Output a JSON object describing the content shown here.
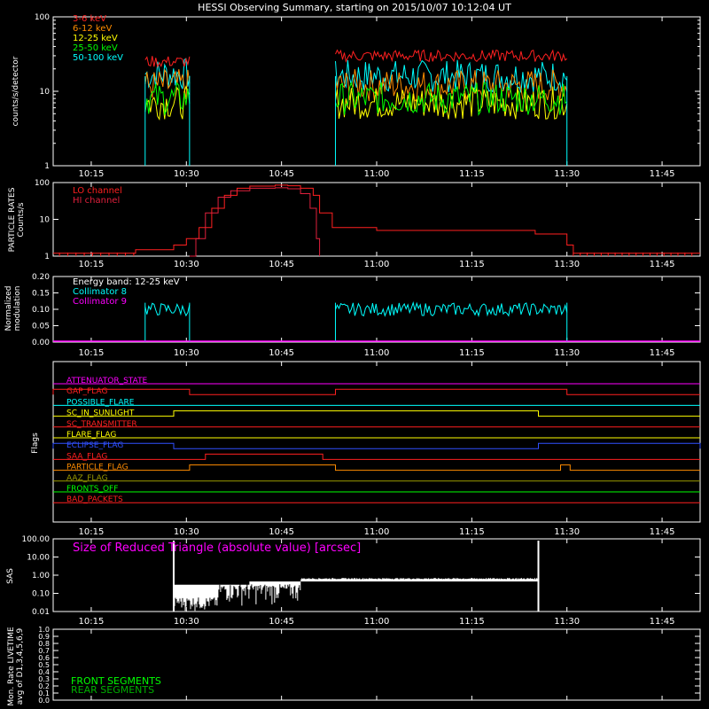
{
  "title": "HESSI Observing Summary, starting on 2015/10/07 10:12:04 UT",
  "x_axis": {
    "start_min": 9,
    "end_min": 111,
    "tick_minutes": [
      15,
      30,
      45,
      60,
      75,
      90,
      105
    ],
    "tick_labels": [
      "10:15",
      "10:30",
      "10:45",
      "11:00",
      "11:15",
      "11:30",
      "11:45"
    ]
  },
  "colors": {
    "red": "#ff2020",
    "orange": "#ff8c00",
    "yellow": "#ffff00",
    "green": "#00ff00",
    "cyan": "#00ffff",
    "magenta": "#ff00ff",
    "blue": "#3050ff",
    "olive": "#9a9a00",
    "darkgreen": "#00b000",
    "crimson": "#e0203c"
  },
  "chart_data": [
    {
      "type": "line",
      "name": "count-rates",
      "ylabel": "counts/s/detector",
      "yscale": "log",
      "ylim": [
        1,
        100
      ],
      "yticks": [
        "1",
        "10",
        "100"
      ],
      "intervals_min": [
        [
          23.5,
          30.5
        ],
        [
          53.5,
          90.0
        ]
      ],
      "series": [
        {
          "name": "3-6 keV",
          "color": "#ff2020",
          "level_int1": 25,
          "level_int2": 30
        },
        {
          "name": "6-12 keV",
          "color": "#ff8c00",
          "level_int1": 12,
          "level_int2": 12
        },
        {
          "name": "12-25 keV",
          "color": "#ffff00",
          "level_int1": 7,
          "level_int2": 7
        },
        {
          "name": "25-50 keV",
          "color": "#00ff00",
          "level_int1": 8,
          "level_int2": 8
        },
        {
          "name": "50-100 keV",
          "color": "#00ffff",
          "level_int1": 17,
          "level_int2": 16
        }
      ]
    },
    {
      "type": "line",
      "name": "particle-rates",
      "ylabel": [
        "PARTICLE RATES",
        "Counts/s"
      ],
      "yscale": "log",
      "ylim": [
        1,
        100
      ],
      "yticks": [
        "1",
        "10",
        "100"
      ],
      "series": [
        {
          "name": "LO channel",
          "color": "#ff2020",
          "points": [
            [
              9,
              1.2
            ],
            [
              22,
              1.5
            ],
            [
              28,
              2
            ],
            [
              30,
              3
            ],
            [
              32,
              6
            ],
            [
              34,
              20
            ],
            [
              36,
              45
            ],
            [
              38,
              70
            ],
            [
              40,
              80
            ],
            [
              44,
              85
            ],
            [
              46,
              82
            ],
            [
              48,
              70
            ],
            [
              50,
              45
            ],
            [
              51,
              15
            ],
            [
              53,
              6
            ],
            [
              60,
              5
            ],
            [
              75,
              5
            ],
            [
              85,
              4
            ],
            [
              90,
              2
            ],
            [
              91,
              1.2
            ],
            [
              111,
              1.2
            ]
          ]
        },
        {
          "name": "HI channel",
          "color": "#e0203c",
          "points": [
            [
              30.5,
              1
            ],
            [
              31.5,
              3
            ],
            [
              33,
              15
            ],
            [
              35,
              40
            ],
            [
              37,
              60
            ],
            [
              40,
              70
            ],
            [
              44,
              72
            ],
            [
              46,
              68
            ],
            [
              48,
              50
            ],
            [
              49.5,
              20
            ],
            [
              50.5,
              3
            ],
            [
              51,
              1
            ]
          ]
        }
      ]
    },
    {
      "type": "line",
      "name": "modulation",
      "ylabel": [
        "Normalized",
        "modulation"
      ],
      "ylim": [
        0.0,
        0.2
      ],
      "yticks": [
        "0.00",
        "0.05",
        "0.10",
        "0.15",
        "0.20"
      ],
      "annotation": "Energy band: 12-25 keV",
      "series": [
        {
          "name": "Collimator 8",
          "color": "#00ffff",
          "level": 0.1,
          "intervals_min": [
            [
              23.5,
              30.5
            ],
            [
              53.5,
              90.0
            ]
          ]
        },
        {
          "name": "Collimator 9",
          "color": "#ff00ff",
          "level": 0.0
        }
      ]
    },
    {
      "type": "line",
      "name": "flags",
      "ylabel": "Flags",
      "flags": [
        {
          "label": "ATTENUATOR_STATE",
          "color": "#ff00ff",
          "segments": []
        },
        {
          "label": "GAP_FLAG",
          "color": "#ff2020",
          "segments": [
            [
              9,
              30.5
            ],
            [
              53.5,
              90
            ]
          ]
        },
        {
          "label": "POSSIBLE_FLARE",
          "color": "#00ffff",
          "segments": []
        },
        {
          "label": "SC_IN_SUNLIGHT",
          "color": "#ffff00",
          "segments": [
            [
              28,
              85.5
            ]
          ]
        },
        {
          "label": "SC_TRANSMITTER",
          "color": "#ff2020",
          "segments": []
        },
        {
          "label": "FLARE_FLAG",
          "color": "#ffff00",
          "segments": []
        },
        {
          "label": "ECLIPSE_FLAG",
          "color": "#3050ff",
          "segments": [
            [
              9,
              28
            ],
            [
              85.5,
              111
            ]
          ]
        },
        {
          "label": "SAA_FLAG",
          "color": "#ff2020",
          "segments": [
            [
              33,
              51.5
            ]
          ]
        },
        {
          "label": "PARTICLE_FLAG",
          "color": "#ff8c00",
          "segments": [
            [
              30.5,
              53.5
            ],
            [
              89,
              90.5
            ]
          ]
        },
        {
          "label": "AAZ_FLAG",
          "color": "#9a9a00",
          "segments": []
        },
        {
          "label": "FRONTS_OFF",
          "color": "#00ff00",
          "segments": []
        },
        {
          "label": "BAD_PACKETS",
          "color": "#ff2020",
          "segments": []
        }
      ]
    },
    {
      "type": "line",
      "name": "sas",
      "ylabel": "SAS",
      "yscale": "log",
      "ylim": [
        0.01,
        100
      ],
      "yticks": [
        "0.01",
        "0.10",
        "1.00",
        "10.00",
        "100.00"
      ],
      "series": [
        {
          "name": "Size of Reduced Triangle (absolute value) [arcsec]",
          "color": "#ffffff",
          "interval_min": [
            28,
            85.5
          ],
          "level": 0.5
        }
      ]
    },
    {
      "type": "line",
      "name": "monitor-livetime",
      "ylabel": [
        "Mon. Rate LIVETIME",
        "avg of D1,3,4,5,6,9"
      ],
      "ylim": [
        0.0,
        1.0
      ],
      "yticks": [
        "0.0",
        "0.1",
        "0.2",
        "0.3",
        "0.4",
        "0.5",
        "0.6",
        "0.7",
        "0.8",
        "0.9",
        "1.0"
      ],
      "series": [
        {
          "name": "FRONT SEGMENTS",
          "color": "#00ff00"
        },
        {
          "name": "REAR SEGMENTS",
          "color": "#00b000"
        }
      ]
    }
  ]
}
